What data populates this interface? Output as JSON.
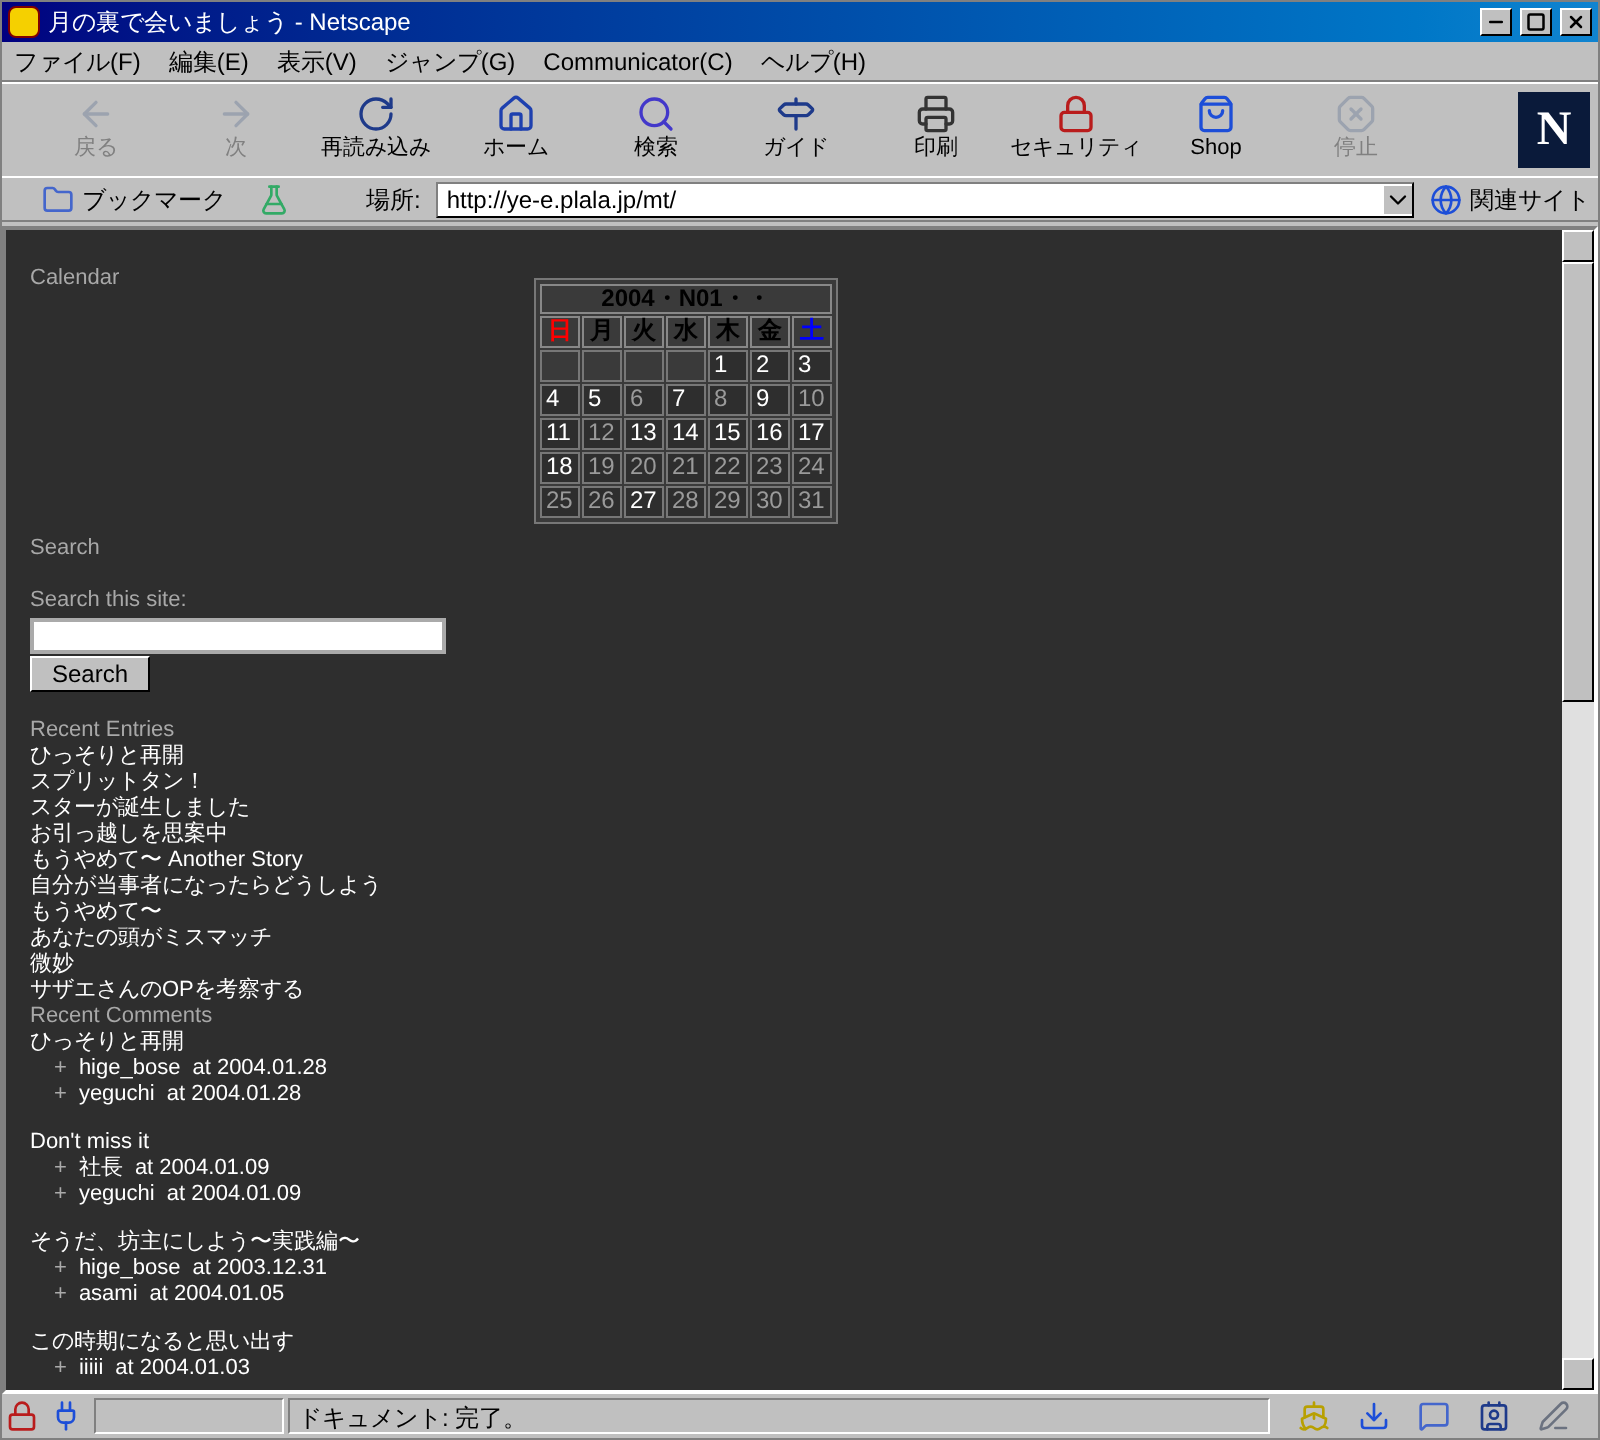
{
  "window": {
    "title": "月の裏で会いましょう - Netscape"
  },
  "menu": [
    "ファイル(F)",
    "編集(E)",
    "表示(V)",
    "ジャンプ(G)",
    "Communicator(C)",
    "ヘルプ(H)"
  ],
  "toolbar": [
    {
      "kind": "back",
      "label": "戻る",
      "disabled": true
    },
    {
      "kind": "forward",
      "label": "次",
      "disabled": true
    },
    {
      "kind": "reload",
      "label": "再読み込み",
      "disabled": false
    },
    {
      "kind": "home",
      "label": "ホーム",
      "disabled": false
    },
    {
      "kind": "search",
      "label": "検索",
      "disabled": false
    },
    {
      "kind": "guide",
      "label": "ガイド",
      "disabled": false
    },
    {
      "kind": "print",
      "label": "印刷",
      "disabled": false
    },
    {
      "kind": "security",
      "label": "セキュリティ",
      "disabled": false
    },
    {
      "kind": "shop",
      "label": "Shop",
      "disabled": false
    },
    {
      "kind": "stop",
      "label": "停止",
      "disabled": true
    }
  ],
  "logo": "N",
  "location_bar": {
    "bookmarks": "ブックマーク",
    "label": "場所:",
    "url": "http://ye-e.plala.jp/mt/",
    "related": "関連サイト"
  },
  "calendar": {
    "heading": "Calendar",
    "title": "2004・N01・・",
    "weekdays": [
      {
        "label": "日",
        "color": "#ff0000"
      },
      {
        "label": "月",
        "color": "#000000"
      },
      {
        "label": "火",
        "color": "#000000"
      },
      {
        "label": "水",
        "color": "#000000"
      },
      {
        "label": "木",
        "color": "#000000"
      },
      {
        "label": "金",
        "color": "#000000"
      },
      {
        "label": "土",
        "color": "#0000ff"
      }
    ],
    "days": [
      {
        "kind": "blank"
      },
      {
        "kind": "blank"
      },
      {
        "kind": "blank"
      },
      {
        "kind": "blank"
      },
      {
        "day": "1",
        "linked": true
      },
      {
        "day": "2",
        "linked": true
      },
      {
        "day": "3",
        "linked": true
      },
      {
        "day": "4",
        "linked": true
      },
      {
        "day": "5",
        "linked": true
      },
      {
        "day": "6",
        "linked": false
      },
      {
        "day": "7",
        "linked": true
      },
      {
        "day": "8",
        "linked": false
      },
      {
        "day": "9",
        "linked": true
      },
      {
        "day": "10",
        "linked": false
      },
      {
        "day": "11",
        "linked": true
      },
      {
        "day": "12",
        "linked": false
      },
      {
        "day": "13",
        "linked": true
      },
      {
        "day": "14",
        "linked": true
      },
      {
        "day": "15",
        "linked": true
      },
      {
        "day": "16",
        "linked": true
      },
      {
        "day": "17",
        "linked": true
      },
      {
        "day": "18",
        "linked": true
      },
      {
        "day": "19",
        "linked": false
      },
      {
        "day": "20",
        "linked": false
      },
      {
        "day": "21",
        "linked": false
      },
      {
        "day": "22",
        "linked": false
      },
      {
        "day": "23",
        "linked": false
      },
      {
        "day": "24",
        "linked": false
      },
      {
        "day": "25",
        "linked": false
      },
      {
        "day": "26",
        "linked": false
      },
      {
        "day": "27",
        "linked": true
      },
      {
        "day": "28",
        "linked": false
      },
      {
        "day": "29",
        "linked": false
      },
      {
        "day": "30",
        "linked": false
      },
      {
        "day": "31",
        "linked": false
      }
    ]
  },
  "search": {
    "heading": "Search",
    "label": "Search this site:",
    "button": "Search"
  },
  "recent_entries": {
    "heading": "Recent Entries",
    "items": [
      "ひっそりと再開",
      "スプリットタン！",
      "スターが誕生しました",
      "お引っ越しを思案中",
      "もうやめて〜 Another Story",
      "自分が当事者になったらどうしよう",
      "もうやめて〜",
      "あなたの頭がミスマッチ",
      "微妙",
      "サザエさんのOPを考察する"
    ]
  },
  "recent_comments": {
    "heading": "Recent Comments",
    "posts": [
      {
        "title": "ひっそりと再開",
        "comments": [
          {
            "bullet": "+",
            "author": "hige_bose",
            "date": "at 2004.01.28"
          },
          {
            "bullet": "+",
            "author": "yeguchi",
            "date": "at 2004.01.28"
          }
        ]
      },
      {
        "title": "Don't miss it",
        "comments": [
          {
            "bullet": "+",
            "author": "社長",
            "date": "at 2004.01.09"
          },
          {
            "bullet": "+",
            "author": "yeguchi",
            "date": "at 2004.01.09"
          }
        ]
      },
      {
        "title": "そうだ、坊主にしよう〜実践編〜",
        "comments": [
          {
            "bullet": "+",
            "author": "hige_bose",
            "date": "at 2003.12.31"
          },
          {
            "bullet": "+",
            "author": "asami",
            "date": "at 2004.01.05"
          }
        ]
      },
      {
        "title": "この時期になると思い出す",
        "comments": [
          {
            "bullet": "+",
            "author": "iiiii",
            "date": "at 2004.01.03"
          }
        ]
      }
    ]
  },
  "status_bar": {
    "text": "ドキュメント: 完了。"
  }
}
